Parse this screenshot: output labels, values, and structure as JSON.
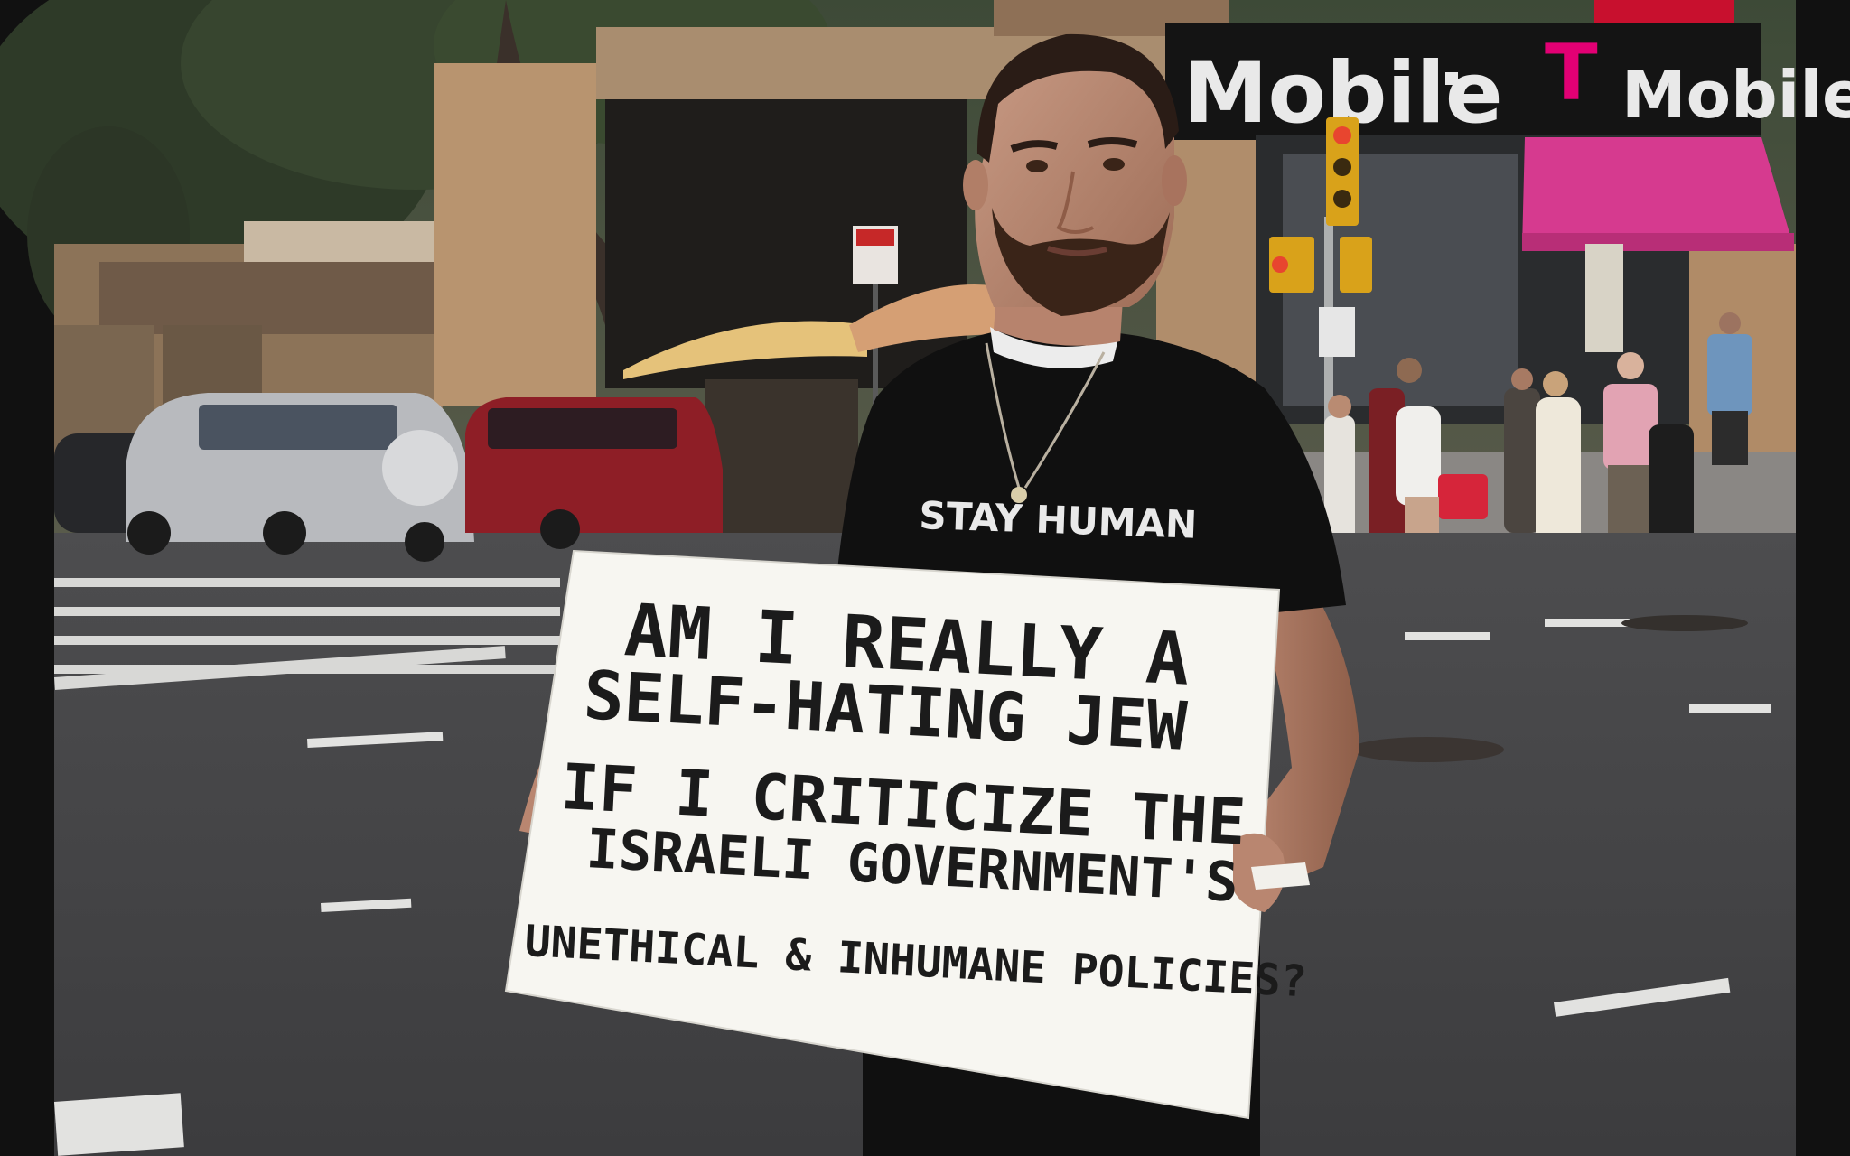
{
  "photo": {
    "store_sign_left": "Mobile",
    "store_sign_right_letter": "T",
    "store_sign_right": "Mobile",
    "shirt_text": "STAY HUMAN",
    "protest_sign": {
      "line1": "AM  I  REALLY A",
      "line2": "SELF-HATING JEW",
      "line3": "IF I CRITICIZE THE",
      "line4": "ISRAELI GOVERNMENT'S",
      "line5": "UNETHICAL & INHUMANE POLICIES?"
    }
  },
  "colors": {
    "letterbox": "#111111",
    "tmobile_magenta": "#e20074",
    "awning": "#d63a8f",
    "sign_board": "#f7f6f1",
    "shirt": "#101010"
  },
  "icons": {
    "traffic_light": "traffic-light-icon"
  }
}
